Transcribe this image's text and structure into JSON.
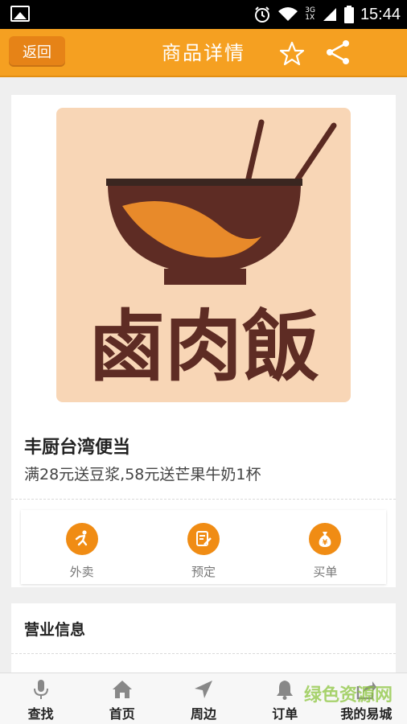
{
  "status_bar": {
    "time": "15:44",
    "network": "3G",
    "network2": "1X"
  },
  "header": {
    "back_label": "返回",
    "title": "商品详情"
  },
  "product": {
    "image_text": "鹵肉飯",
    "name": "丰厨台湾便当",
    "promo": "满28元送豆浆,58元送芒果牛奶1杯"
  },
  "actions": [
    {
      "label": "外卖",
      "icon": "running-person-icon"
    },
    {
      "label": "预定",
      "icon": "edit-note-icon"
    },
    {
      "label": "买单",
      "icon": "money-bag-icon"
    }
  ],
  "business_info": {
    "title": "营业信息"
  },
  "bottom_nav": [
    {
      "label": "查找",
      "icon": "microphone-icon"
    },
    {
      "label": "首页",
      "icon": "home-icon"
    },
    {
      "label": "周边",
      "icon": "navigation-arrow-icon"
    },
    {
      "label": "订单",
      "icon": "bell-icon"
    },
    {
      "label": "我的易城",
      "icon": "share-box-icon"
    }
  ],
  "watermark": "绿色资源网",
  "colors": {
    "header": "#f5a021",
    "accent": "#f08c14",
    "back_button": "#e68317"
  }
}
